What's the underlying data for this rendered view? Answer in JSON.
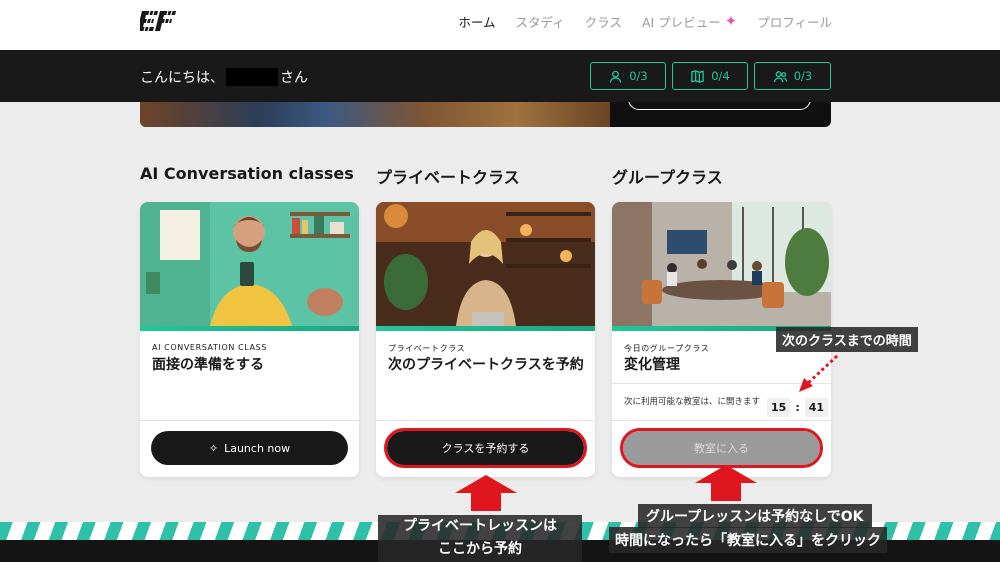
{
  "nav": {
    "items": [
      {
        "label": "ホーム",
        "active": true
      },
      {
        "label": "スタディ",
        "active": false
      },
      {
        "label": "クラス",
        "active": false
      },
      {
        "label": "AI プレビュー",
        "active": false,
        "icon": "sparkle-icon"
      },
      {
        "label": "プロフィール",
        "active": false
      }
    ]
  },
  "greeting": {
    "prefix": "こんにちは、",
    "suffix": "さん"
  },
  "stats": [
    {
      "icon": "person-icon",
      "value": "0/3"
    },
    {
      "icon": "book-icon",
      "value": "0/4"
    },
    {
      "icon": "group-icon",
      "value": "0/3"
    }
  ],
  "columns": {
    "ai": {
      "title": "AI Conversation classes",
      "kicker": "AI CONVERSATION CLASS",
      "card_title": "面接の準備をする",
      "button": "Launch now"
    },
    "private": {
      "title": "プライベートクラス",
      "kicker": "プライベートクラス",
      "card_title": "次のプライベートクラスを予約",
      "button": "クラスを予約する"
    },
    "group": {
      "title": "グループクラス",
      "kicker": "今日のグループクラス",
      "card_title": "変化管理",
      "next_info": "次に利用可能な教室は、に開きます",
      "timer_min": "15",
      "timer_sep": ":",
      "timer_sec": "41",
      "button": "教室に入る"
    }
  },
  "annotations": {
    "time_label": "次のクラスまでの時間",
    "private_line1": "プライベートレッスンは",
    "private_line2": "ここから予約",
    "group_line1": "グループレッスンは予約なしでOK",
    "group_line2": "時間になったら「教室に入る」をクリック"
  },
  "colors": {
    "accent": "#21c79a",
    "highlight": "#e0161e",
    "dark": "#191919"
  }
}
